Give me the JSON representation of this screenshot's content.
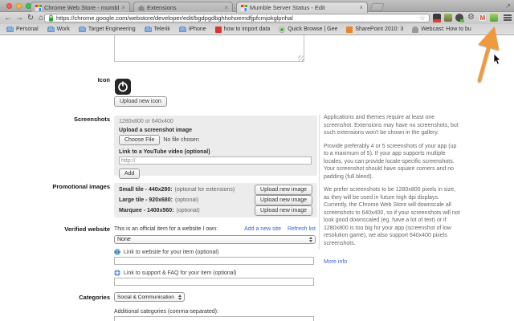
{
  "window": {
    "tabs": [
      {
        "title": "Chrome Web Store - mumbl",
        "icon": "webstore-favicon"
      },
      {
        "title": "Extensions",
        "icon": "extensions-puzzle-favicon"
      },
      {
        "title": "Mumble Server Status - Edit",
        "icon": "webstore-favicon"
      }
    ],
    "toolbar": {
      "url": "https://chrome.google.com/webstore/developer/edit/bgdpgdbghhohoemdfjpfcmjokglpnhal",
      "extension_icons": [
        "counter-badge-extension",
        "persona-extension",
        "shield-badge-extension",
        "gear-extension",
        "gmail-extension",
        "green-extension"
      ]
    },
    "bookmarks": [
      {
        "label": "Personal",
        "icon": "folder"
      },
      {
        "label": "Work",
        "icon": "folder"
      },
      {
        "label": "Target Engineering",
        "icon": "folder"
      },
      {
        "label": "Telerik",
        "icon": "folder"
      },
      {
        "label": "iPhone",
        "icon": "folder"
      },
      {
        "label": "how to import data",
        "icon": "red-favicon"
      },
      {
        "label": "Quick Browse | Gee",
        "icon": "green-check-favicon"
      },
      {
        "label": "SharePoint 2010: 3",
        "icon": "orange-favicon"
      },
      {
        "label": "Webcast: How to bu",
        "icon": "people-favicon"
      }
    ]
  },
  "form": {
    "icon": {
      "label": "Icon",
      "upload_button": "Upload new icon"
    },
    "screenshots": {
      "label": "Screenshots",
      "size_hint": "1280x800 or 640x400",
      "upload_heading": "Upload a screenshot image",
      "choose_file_button": "Choose File",
      "no_file_text": "No file chosen",
      "youtube_heading": "Link to a YouTube video (optional)",
      "youtube_value": "http://",
      "add_button": "Add"
    },
    "promo": {
      "label": "Promotional images",
      "upload_button": "Upload new image",
      "rows": [
        {
          "name": "Small tile - 440x280:",
          "note": "(optional for extensions)"
        },
        {
          "name": "Large tile - 920x680:",
          "note": "(optional)"
        },
        {
          "name": "Marquee - 1400x560:",
          "note": "(optional)"
        }
      ]
    },
    "verified": {
      "label": "Verified website",
      "text": "This is an official item for a website I own:",
      "add_site_link": "Add a new site",
      "refresh_link": "Refresh list",
      "selected": "None"
    },
    "website_link_heading": "Link to website for your item (optional)",
    "support_link_heading": "Link to support & FAQ for your item (optional)",
    "categories": {
      "label": "Categories",
      "selected": "Social & Communication",
      "additional_label": "Additional categories (comma-separated):"
    }
  },
  "help": {
    "paragraphs": [
      "Applications and themes require at least one screenshot. Extensions may have no screenshots, but such extensions won't be shown in the gallery.",
      "Provide preferably 4 or 5 screenshots of your app (up to a maximum of 5). If your app supports multiple locales, you can provide locale-specific screenshots. Your screenshot should have square corners and no padding (full bleed).",
      "We prefer screenshots to be 1280x800 pixels in size, as they will be used in future high dpi displays. Currently, the Chrome Web Store will downscale all screenshots to 640x400, so if your screenshots will not look good downscaled (eg. have a lot of text) or if 1280x800 is too big for your app (screenshot of low resolution game), we also support 640x400 pixels screenshots."
    ],
    "more_info_link": "More info"
  },
  "annotations": {
    "arrow_color": "#F09A3E"
  }
}
